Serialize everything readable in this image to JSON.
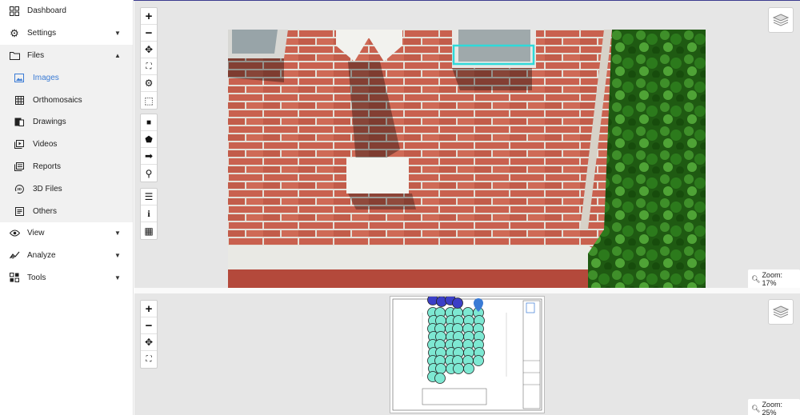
{
  "sidebar": {
    "items": [
      {
        "label": "Dashboard",
        "icon": "dashboard-icon"
      },
      {
        "label": "Settings",
        "icon": "gear-icon",
        "chevron": "▼"
      },
      {
        "label": "Files",
        "icon": "folder-icon",
        "chevron": "▲"
      },
      {
        "label": "View",
        "icon": "eye-icon",
        "chevron": "▼"
      },
      {
        "label": "Analyze",
        "icon": "analyze-icon",
        "chevron": "▼"
      },
      {
        "label": "Tools",
        "icon": "tools-icon",
        "chevron": "▼"
      }
    ],
    "files_sub": [
      {
        "label": "Images",
        "icon": "image-icon",
        "active": true
      },
      {
        "label": "Orthomosaics",
        "icon": "grid-icon"
      },
      {
        "label": "Drawings",
        "icon": "drawings-icon"
      },
      {
        "label": "Videos",
        "icon": "video-icon"
      },
      {
        "label": "Reports",
        "icon": "reports-icon"
      },
      {
        "label": "3D Files",
        "icon": "3d-icon"
      },
      {
        "label": "Others",
        "icon": "document-icon"
      }
    ]
  },
  "top_viewer": {
    "zoom_label": "Zoom: 17%",
    "tools_nav": [
      "+",
      "−",
      "✥",
      "⛶",
      "⚙",
      "⬚"
    ],
    "tools_draw": [
      "■",
      "⬟",
      "➡",
      "⚲"
    ],
    "tools_info": [
      "☰",
      "i",
      "▦"
    ]
  },
  "bottom_viewer": {
    "zoom_label": "Zoom: 25%",
    "tools_nav": [
      "+",
      "−",
      "✥",
      "⛶"
    ]
  },
  "colors": {
    "accent": "#3a7bd5",
    "marker_teal": "#7de8d2",
    "marker_blue": "#3b3fc7",
    "highlight_box": "#2fd9d9"
  }
}
